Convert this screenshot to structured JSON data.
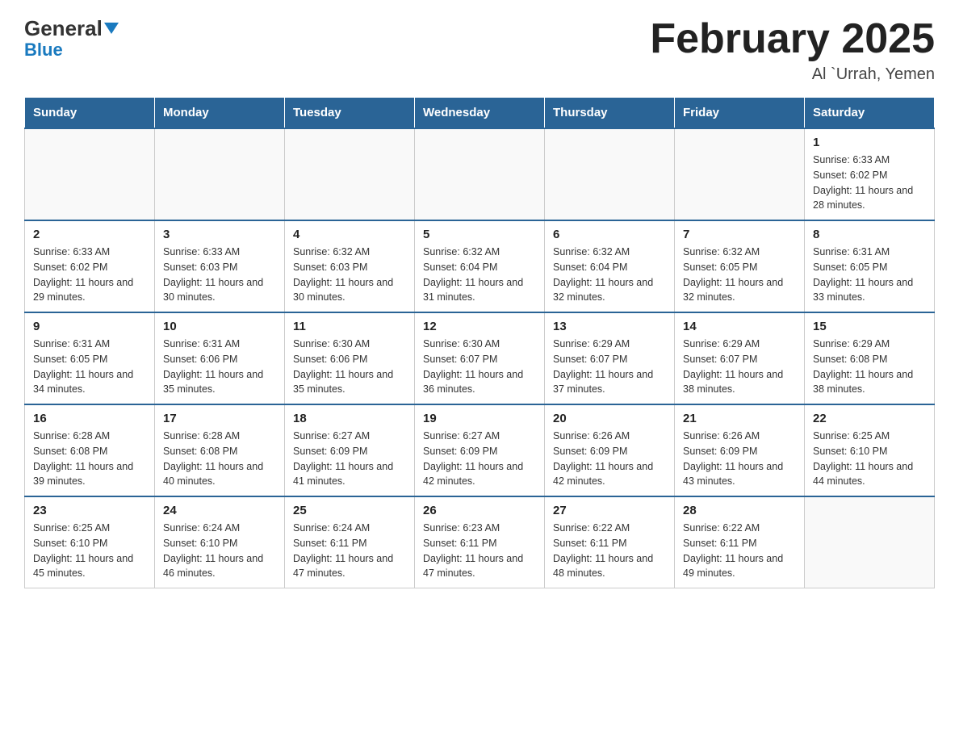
{
  "header": {
    "logo_general": "General",
    "logo_blue": "Blue",
    "month_title": "February 2025",
    "location": "Al `Urrah, Yemen"
  },
  "calendar": {
    "days_of_week": [
      "Sunday",
      "Monday",
      "Tuesday",
      "Wednesday",
      "Thursday",
      "Friday",
      "Saturday"
    ],
    "weeks": [
      {
        "days": [
          {
            "date": "",
            "info": ""
          },
          {
            "date": "",
            "info": ""
          },
          {
            "date": "",
            "info": ""
          },
          {
            "date": "",
            "info": ""
          },
          {
            "date": "",
            "info": ""
          },
          {
            "date": "",
            "info": ""
          },
          {
            "date": "1",
            "info": "Sunrise: 6:33 AM\nSunset: 6:02 PM\nDaylight: 11 hours and 28 minutes."
          }
        ]
      },
      {
        "days": [
          {
            "date": "2",
            "info": "Sunrise: 6:33 AM\nSunset: 6:02 PM\nDaylight: 11 hours and 29 minutes."
          },
          {
            "date": "3",
            "info": "Sunrise: 6:33 AM\nSunset: 6:03 PM\nDaylight: 11 hours and 30 minutes."
          },
          {
            "date": "4",
            "info": "Sunrise: 6:32 AM\nSunset: 6:03 PM\nDaylight: 11 hours and 30 minutes."
          },
          {
            "date": "5",
            "info": "Sunrise: 6:32 AM\nSunset: 6:04 PM\nDaylight: 11 hours and 31 minutes."
          },
          {
            "date": "6",
            "info": "Sunrise: 6:32 AM\nSunset: 6:04 PM\nDaylight: 11 hours and 32 minutes."
          },
          {
            "date": "7",
            "info": "Sunrise: 6:32 AM\nSunset: 6:05 PM\nDaylight: 11 hours and 32 minutes."
          },
          {
            "date": "8",
            "info": "Sunrise: 6:31 AM\nSunset: 6:05 PM\nDaylight: 11 hours and 33 minutes."
          }
        ]
      },
      {
        "days": [
          {
            "date": "9",
            "info": "Sunrise: 6:31 AM\nSunset: 6:05 PM\nDaylight: 11 hours and 34 minutes."
          },
          {
            "date": "10",
            "info": "Sunrise: 6:31 AM\nSunset: 6:06 PM\nDaylight: 11 hours and 35 minutes."
          },
          {
            "date": "11",
            "info": "Sunrise: 6:30 AM\nSunset: 6:06 PM\nDaylight: 11 hours and 35 minutes."
          },
          {
            "date": "12",
            "info": "Sunrise: 6:30 AM\nSunset: 6:07 PM\nDaylight: 11 hours and 36 minutes."
          },
          {
            "date": "13",
            "info": "Sunrise: 6:29 AM\nSunset: 6:07 PM\nDaylight: 11 hours and 37 minutes."
          },
          {
            "date": "14",
            "info": "Sunrise: 6:29 AM\nSunset: 6:07 PM\nDaylight: 11 hours and 38 minutes."
          },
          {
            "date": "15",
            "info": "Sunrise: 6:29 AM\nSunset: 6:08 PM\nDaylight: 11 hours and 38 minutes."
          }
        ]
      },
      {
        "days": [
          {
            "date": "16",
            "info": "Sunrise: 6:28 AM\nSunset: 6:08 PM\nDaylight: 11 hours and 39 minutes."
          },
          {
            "date": "17",
            "info": "Sunrise: 6:28 AM\nSunset: 6:08 PM\nDaylight: 11 hours and 40 minutes."
          },
          {
            "date": "18",
            "info": "Sunrise: 6:27 AM\nSunset: 6:09 PM\nDaylight: 11 hours and 41 minutes."
          },
          {
            "date": "19",
            "info": "Sunrise: 6:27 AM\nSunset: 6:09 PM\nDaylight: 11 hours and 42 minutes."
          },
          {
            "date": "20",
            "info": "Sunrise: 6:26 AM\nSunset: 6:09 PM\nDaylight: 11 hours and 42 minutes."
          },
          {
            "date": "21",
            "info": "Sunrise: 6:26 AM\nSunset: 6:09 PM\nDaylight: 11 hours and 43 minutes."
          },
          {
            "date": "22",
            "info": "Sunrise: 6:25 AM\nSunset: 6:10 PM\nDaylight: 11 hours and 44 minutes."
          }
        ]
      },
      {
        "days": [
          {
            "date": "23",
            "info": "Sunrise: 6:25 AM\nSunset: 6:10 PM\nDaylight: 11 hours and 45 minutes."
          },
          {
            "date": "24",
            "info": "Sunrise: 6:24 AM\nSunset: 6:10 PM\nDaylight: 11 hours and 46 minutes."
          },
          {
            "date": "25",
            "info": "Sunrise: 6:24 AM\nSunset: 6:11 PM\nDaylight: 11 hours and 47 minutes."
          },
          {
            "date": "26",
            "info": "Sunrise: 6:23 AM\nSunset: 6:11 PM\nDaylight: 11 hours and 47 minutes."
          },
          {
            "date": "27",
            "info": "Sunrise: 6:22 AM\nSunset: 6:11 PM\nDaylight: 11 hours and 48 minutes."
          },
          {
            "date": "28",
            "info": "Sunrise: 6:22 AM\nSunset: 6:11 PM\nDaylight: 11 hours and 49 minutes."
          },
          {
            "date": "",
            "info": ""
          }
        ]
      }
    ]
  }
}
